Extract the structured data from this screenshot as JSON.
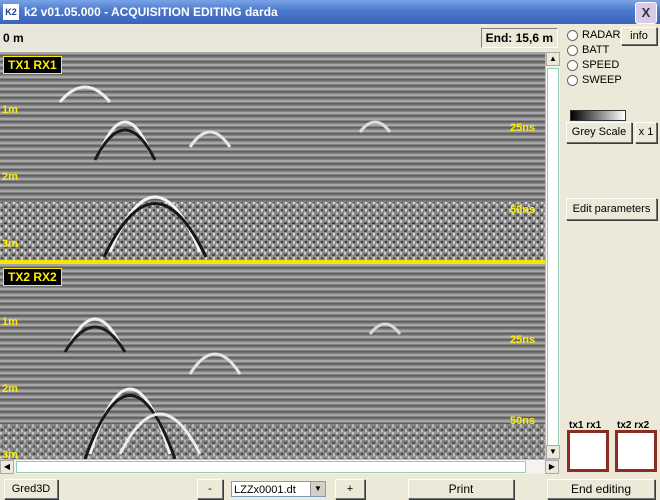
{
  "window": {
    "logo": "K2",
    "title": "k2 v01.05.000 - ACQUISITION EDITING  darda",
    "close": "X"
  },
  "scan": {
    "start": "0 m",
    "end": "End: 15,6 m"
  },
  "channels": [
    {
      "label": "TX1 RX1",
      "depth_labels": [
        "1m",
        "2m",
        "3m"
      ],
      "time_labels": [
        "25ns",
        "50ns"
      ]
    },
    {
      "label": "TX2 RX2",
      "depth_labels": [
        "1m",
        "2m",
        "3m"
      ],
      "time_labels": [
        "25ns",
        "50ns"
      ]
    }
  ],
  "status": {
    "radios": [
      "RADAR",
      "BATT",
      "SPEED",
      "SWEEP"
    ],
    "info": "info"
  },
  "display": {
    "grey_scale": "Grey Scale",
    "zoom": "x 1",
    "edit_parameters": "Edit parameters"
  },
  "channel_boxes": [
    "tx1 rx1",
    "tx2 rx2"
  ],
  "bottom": {
    "gred3d": "Gred3D",
    "minus": "-",
    "file": "LZZx0001.dt",
    "plus": "+",
    "print": "Print",
    "end_editing": "End editing"
  },
  "colors": {
    "accent": "#f6e600",
    "box_border": "#8a2c20"
  }
}
